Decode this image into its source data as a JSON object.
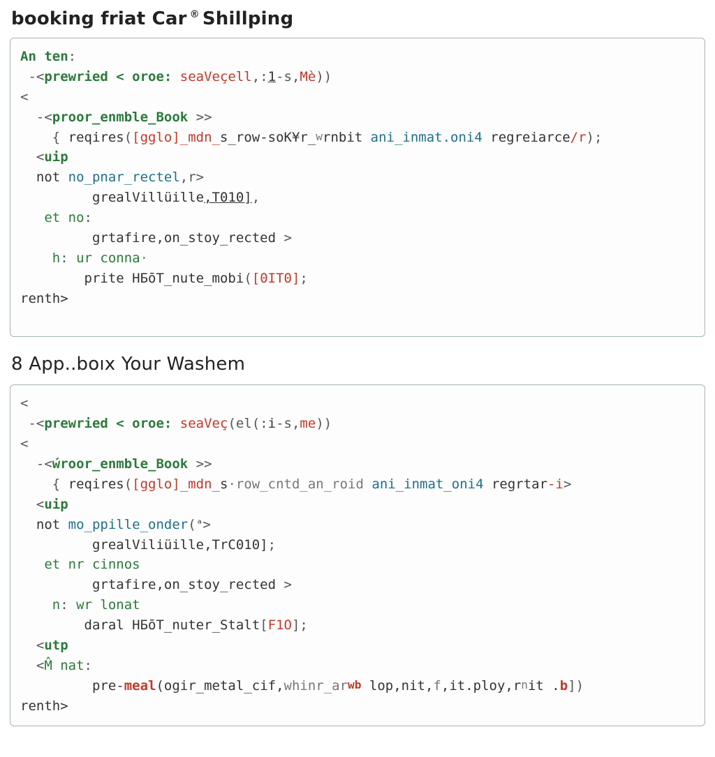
{
  "doc": {
    "heading1_a": "booking friat Car",
    "heading1_b": "Shillping",
    "heading2": "8 App..boıx Your Washem",
    "code1": {
      "l1_a": "An ten",
      "l1_colon": ":",
      "l2_a": " -<",
      "l2_b": "prewried",
      "l2_c": " < oroe:",
      "l2_d": " seaVeçell",
      "l2_e": ",:",
      "l2_f": "1",
      "l2_g": "-s,",
      "l2_h": "Mè",
      "l2_i": "))",
      "l3": "<",
      "l4_a": "  -<",
      "l4_b": "proor_enmble_Book",
      "l4_c": " >>",
      "l5_a": "    { ",
      "l5_b": "reqires",
      "l5_c": "(",
      "l5_d": "[gglo]_mdn_",
      "l5_e": "s_row",
      "l5_f": "-soK¥r_",
      "l5_g": "w",
      "l5_h": "rnbit ",
      "l5_i": "ani_inmat.oni4",
      "l5_j": " regreiarce",
      "l5_k": "/r",
      "l5_l": ");",
      "l6_a": "  <",
      "l6_b": "uip",
      "l7_a": "  not ",
      "l7_b": "no_pnar_rectel",
      "l7_c": ",r>",
      "l8_a": "         grealVillüille",
      "l8_b": ",T010]",
      "l8_c": ",",
      "l9_a": "   ",
      "l9_b": "et no",
      "l9_c": ":",
      "l10_a": "         grtafire,on_stoy_rected ",
      "l10_b": ">",
      "l11_a": "    ",
      "l11_b": "h",
      "l11_c": ": ",
      "l11_d": "ur conna",
      "l11_e": "·",
      "l12_a": "        prite ",
      "l12_b": "HБōT_nute_mobi",
      "l12_c": "(",
      "l12_d": "[0IT0]",
      "l12_e": ";",
      "l13": "renth>"
    },
    "code2": {
      "l1": "<",
      "l2_a": " -<",
      "l2_b": "prewried",
      "l2_c": " < oroe:",
      "l2_d": " seaVeç",
      "l2_e": "(el(:",
      "l2_f": "i",
      "l2_g": "-s,",
      "l2_h": "me",
      "l2_i": "))",
      "l3": "<",
      "l4_a": "  -<",
      "l4_b": "ẃroor_enmble_Book",
      "l4_c": " >>",
      "l5_a": "    { ",
      "l5_b": "reqires",
      "l5_c": "(",
      "l5_d": "[gglo]_mdn_",
      "l5_e": "s",
      "l5_f": "·row_cntd_an_roid ",
      "l5_g": "ani_inmat_oni4",
      "l5_h": " regrtar",
      "l5_i": "-i",
      "l5_j": ">",
      "l6_a": "  <",
      "l6_b": "uip",
      "l7_a": "  not ",
      "l7_b": "mo_ppille_onder",
      "l7_c": "(",
      "l7_d": "ᵃ",
      "l7_e": ">",
      "l8_a": "         grealViliüille,TrC010]",
      "l8_b": ";",
      "l9_a": "   ",
      "l9_b": "et nr cinnos",
      "l10_a": "         grtafire,on_stoy_rected ",
      "l10_b": ">",
      "l11_a": "    ",
      "l11_b": "n",
      "l11_c": ": ",
      "l11_d": "wr lonat",
      "l12_a": "        daral ",
      "l12_b": "HБōT_nuter_Stalt",
      "l12_c": "[",
      "l12_d": "F1O",
      "l12_e": "]",
      "l12_f": ";",
      "l13_a": "  <",
      "l13_b": "utp",
      "l14_a": "  <",
      "l14_b": "M̂ nat",
      "l14_c": ":",
      "l15_a": "         pre-",
      "l15_b": "meal",
      "l15_c": "(ogir_metal_cif,",
      "l15_d": "whinr_ar",
      "l15_e": "wb",
      "l15_f": " lop,nit,",
      "l15_g": "f",
      "l15_h": ",it.ploy,r",
      "l15_i": "n",
      "l15_j": "it .",
      "l15_k": "b",
      "l15_l": "])",
      "l16": "renth>"
    }
  }
}
